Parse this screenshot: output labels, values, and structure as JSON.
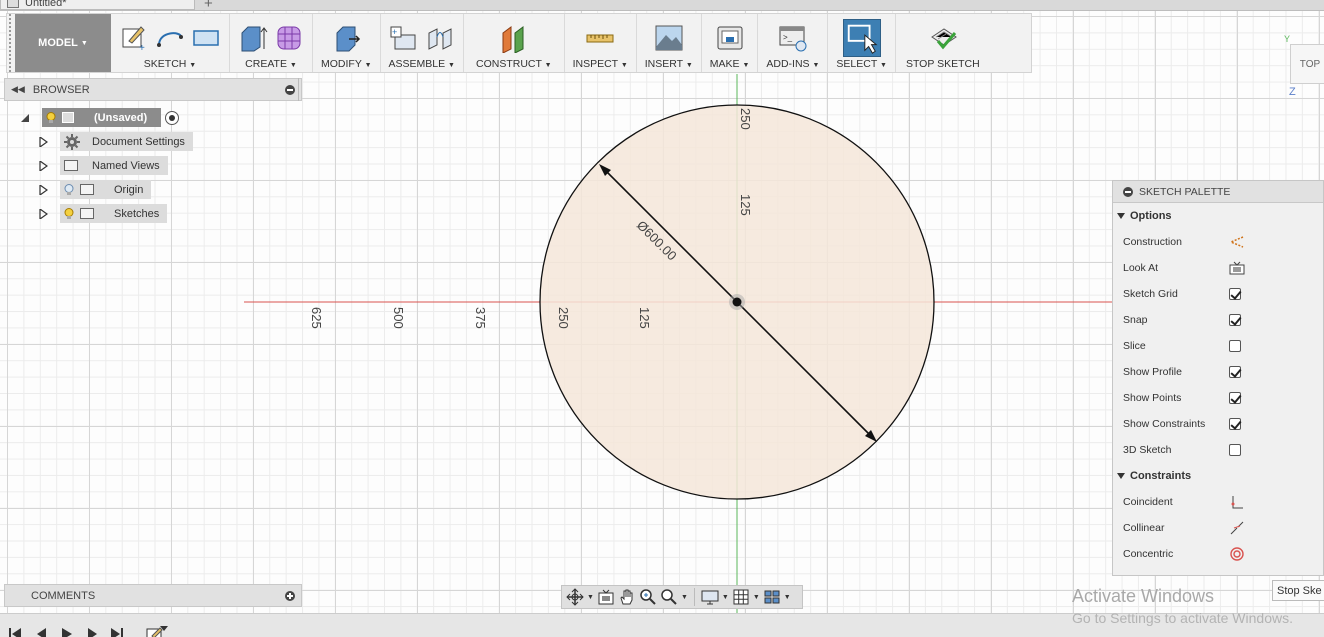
{
  "document": {
    "tab_title": "Untitled*",
    "new_tab_symbol": "+"
  },
  "toolbar": {
    "model_label": "MODEL",
    "groups": [
      {
        "label": "SKETCH"
      },
      {
        "label": "CREATE"
      },
      {
        "label": "MODIFY"
      },
      {
        "label": "ASSEMBLE"
      },
      {
        "label": "CONSTRUCT"
      },
      {
        "label": "INSPECT"
      },
      {
        "label": "INSERT"
      },
      {
        "label": "MAKE"
      },
      {
        "label": "ADD-INS"
      },
      {
        "label": "SELECT"
      }
    ],
    "stop_sketch_label": "STOP SKETCH"
  },
  "browser": {
    "title": "BROWSER",
    "root": {
      "label": "(Unsaved)"
    },
    "items": [
      {
        "label": "Document Settings",
        "icon": "gear-icon"
      },
      {
        "label": "Named Views",
        "icon": "folder-icon"
      },
      {
        "label": "Origin",
        "icon": "folder-icon"
      },
      {
        "label": "Sketches",
        "icon": "folder-icon"
      }
    ]
  },
  "comments": {
    "title": "COMMENTS"
  },
  "canvas": {
    "dimension_text": "Ø600.00",
    "ruler_horizontal": [
      "625",
      "500",
      "375",
      "250",
      "125"
    ],
    "ruler_vertical": [
      "250",
      "125"
    ],
    "circle_fill": "#f4e6d9",
    "x_axis_color": "#d9534f",
    "y_axis_color": "#5cb85c"
  },
  "viewcube": {
    "face_label": "TOP",
    "axis_z": "Z",
    "axis_y": "Y"
  },
  "palette": {
    "title": "SKETCH PALETTE",
    "options_heading": "Options",
    "options": [
      {
        "label": "Construction",
        "icon": "construction-icon"
      },
      {
        "label": "Look At",
        "icon": "look-at-icon"
      },
      {
        "label": "Sketch Grid",
        "checked": true
      },
      {
        "label": "Snap",
        "checked": true
      },
      {
        "label": "Slice",
        "checked": false
      },
      {
        "label": "Show Profile",
        "checked": true
      },
      {
        "label": "Show Points",
        "checked": true
      },
      {
        "label": "Show Constraints",
        "checked": true
      },
      {
        "label": "3D Sketch",
        "checked": false
      }
    ],
    "constraints_heading": "Constraints",
    "constraints": [
      {
        "label": "Coincident",
        "icon": "coincident-icon"
      },
      {
        "label": "Collinear",
        "icon": "collinear-icon"
      },
      {
        "label": "Concentric",
        "icon": "concentric-icon"
      }
    ],
    "stop_button": "Stop Ske"
  },
  "watermark": {
    "title": "Activate Windows",
    "subtitle": "Go to Settings to activate Windows."
  }
}
